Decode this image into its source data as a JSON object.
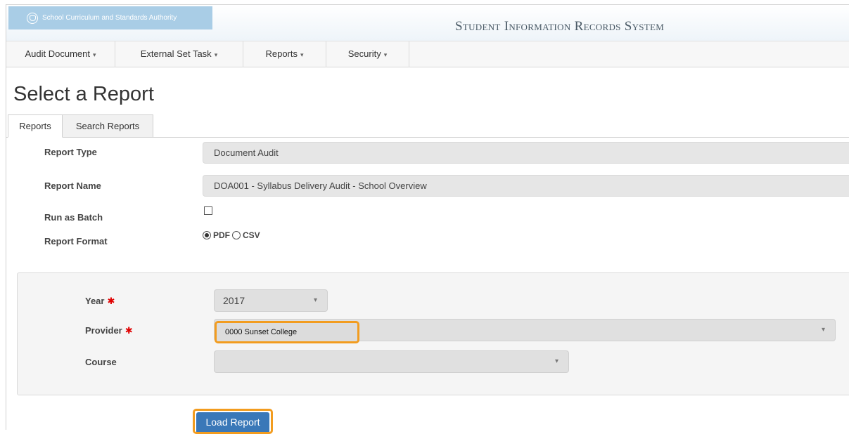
{
  "header": {
    "authority": "School Curriculum and Standards Authority",
    "system_title": "Student Information Records System"
  },
  "nav": {
    "items": [
      {
        "label": "Audit Document"
      },
      {
        "label": "External Set Task"
      },
      {
        "label": "Reports"
      },
      {
        "label": "Security"
      }
    ],
    "caret": "▾"
  },
  "page": {
    "title": "Select a Report"
  },
  "tabs": [
    {
      "label": "Reports",
      "active": true
    },
    {
      "label": "Search Reports",
      "active": false
    }
  ],
  "form": {
    "report_type_label": "Report Type",
    "report_type_value": "Document Audit",
    "report_name_label": "Report Name",
    "report_name_value": "DOA001 - Syllabus Delivery Audit - School Overview",
    "run_as_batch_label": "Run as Batch",
    "run_as_batch_checked": false,
    "report_format_label": "Report Format",
    "format_options": [
      "PDF",
      "CSV"
    ],
    "format_selected": "PDF"
  },
  "filters": {
    "year_label": "Year",
    "year_value": "2017",
    "provider_label": "Provider",
    "provider_value": "0000 Sunset College",
    "course_label": "Course",
    "course_value": "",
    "required_marker": "✱"
  },
  "actions": {
    "load_report": "Load Report"
  },
  "colors": {
    "accent": "#3a78b8",
    "highlight": "#f29c1f",
    "required": "#e00000",
    "logo_bg": "#a9cde6"
  }
}
